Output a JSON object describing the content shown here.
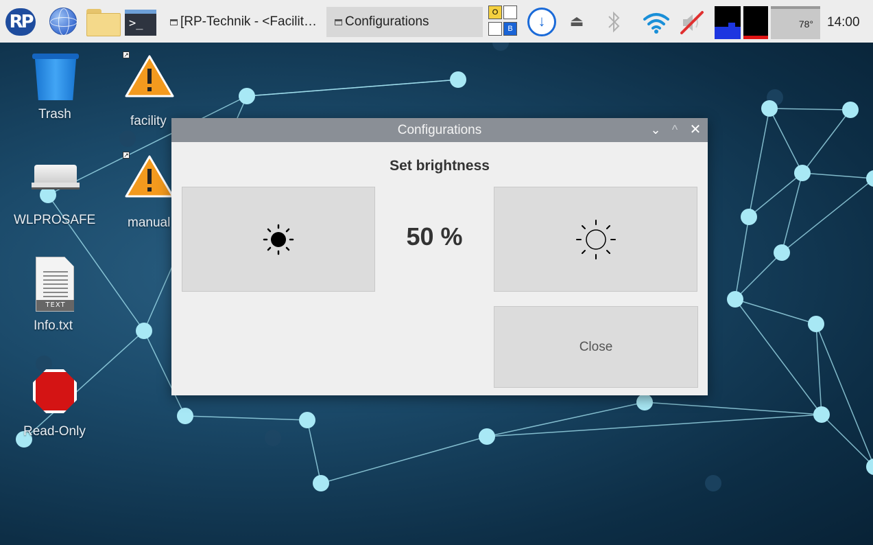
{
  "taskbar": {
    "menu_logo": "RP",
    "browser_icon": "globe-icon",
    "file_manager_icon": "folder-icon",
    "terminal_glyph": ">_",
    "tasks": [
      {
        "label": "[RP-Technik - <Facilit…",
        "active": false
      },
      {
        "label": "Configurations",
        "active": true
      }
    ],
    "keyboard_indicator": {
      "o": "O",
      "b": "B"
    },
    "temperature": "78°",
    "clock": "14:00"
  },
  "desktop": {
    "icons": [
      {
        "label": "Trash",
        "icon": "trash-icon"
      },
      {
        "label": "facility",
        "icon": "warning-icon"
      },
      {
        "label": "WLPROSAFE",
        "icon": "drive-icon"
      },
      {
        "label": "manual",
        "icon": "warning-icon"
      },
      {
        "label": "Info.txt",
        "icon": "text-file-icon",
        "badge": "TEXT"
      },
      {
        "label": "Read-Only",
        "icon": "stop-icon"
      }
    ]
  },
  "dialog": {
    "title": "Configurations",
    "heading": "Set brightness",
    "value": "50 %",
    "darker_icon": "sun-filled-icon",
    "brighter_icon": "sun-outline-icon",
    "close_label": "Close"
  },
  "colors": {
    "taskbar_bg": "#ededed",
    "titlebar_bg": "#8a8f96",
    "dialog_bg": "#efefef",
    "button_bg": "#dcdcdc",
    "network_node": "#a8e8f5"
  }
}
